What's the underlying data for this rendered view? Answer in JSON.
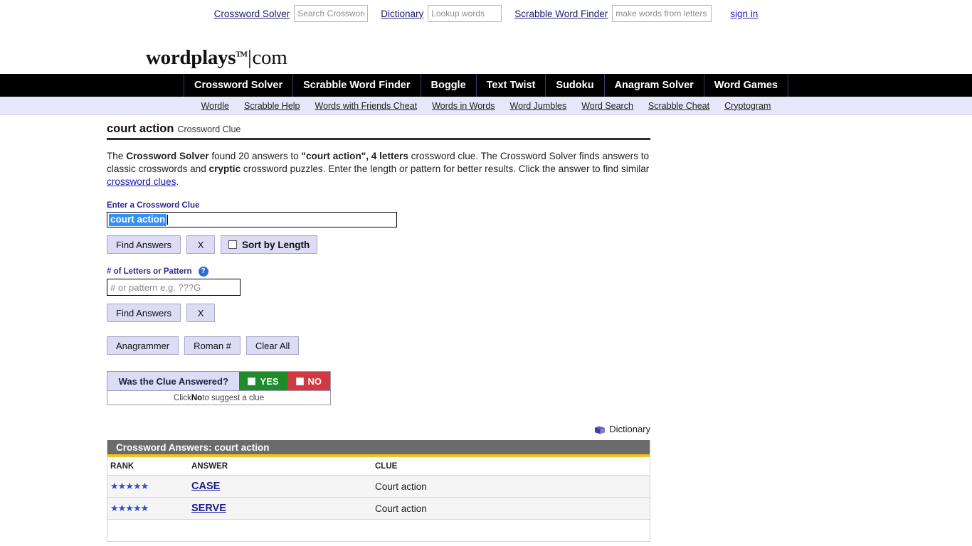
{
  "topbar": {
    "crossword_solver_link": "Crossword Solver",
    "crossword_search_placeholder": "Search Crosswords",
    "dictionary_link": "Dictionary",
    "dictionary_search_placeholder": "Lookup words",
    "scrabble_link": "Scrabble Word Finder",
    "scrabble_search_placeholder": "make words from letters",
    "signin": "sign in"
  },
  "logo": {
    "name": "wordplays",
    "tm": "TM",
    "separator": "|",
    "tld": "com"
  },
  "mainnav": {
    "items": [
      {
        "label": "Crossword Solver"
      },
      {
        "label": "Scrabble Word Finder"
      },
      {
        "label": "Boggle"
      },
      {
        "label": "Text Twist"
      },
      {
        "label": "Sudoku"
      },
      {
        "label": "Anagram Solver"
      },
      {
        "label": "Word Games"
      }
    ]
  },
  "subnav": {
    "items": [
      {
        "label": "Wordle"
      },
      {
        "label": "Scrabble Help"
      },
      {
        "label": "Words with Friends Cheat"
      },
      {
        "label": "Words in Words"
      },
      {
        "label": "Word Jumbles"
      },
      {
        "label": "Word Search"
      },
      {
        "label": "Scrabble Cheat"
      },
      {
        "label": "Cryptogram"
      }
    ]
  },
  "page": {
    "title": "court action",
    "subtitle": "Crossword Clue",
    "blurb": {
      "p1": "The ",
      "solver": "Crossword Solver",
      "p2": " found 20 answers to ",
      "query": "\"court action\", 4 letters",
      "p3": " crossword clue. The Crossword Solver finds answers to classic crosswords and ",
      "cryptic": "cryptic",
      "p4": " crossword puzzles. Enter the length or pattern for better results. Click the answer to find similar ",
      "link": "crossword clues",
      "p5": "."
    }
  },
  "form": {
    "clue_label": "Enter a Crossword Clue",
    "clue_value": "court action",
    "find_answers": "Find Answers",
    "clear_x": "X",
    "sort_by_length": "Sort by Length",
    "pattern_label": "# of Letters or Pattern",
    "help_glyph": "?",
    "pattern_placeholder": "# or pattern e.g. ???G",
    "pattern_value": "",
    "find_answers_2": "Find Answers",
    "clear_x_2": "X",
    "anagrammer": "Anagrammer",
    "roman": "Roman #",
    "clear_all": "Clear All"
  },
  "answered": {
    "question": "Was the Clue Answered?",
    "yes": "YES",
    "no": "NO",
    "note_pre": "Click ",
    "note_bold": "No",
    "note_post": " to suggest a clue"
  },
  "dictionary": {
    "label": "Dictionary"
  },
  "results": {
    "heading": "Crossword Answers: court action",
    "columns": {
      "rank": "RANK",
      "answer": "ANSWER",
      "clue": "CLUE"
    },
    "rows": [
      {
        "stars": "★★★★★",
        "rating": 5,
        "answer": "CASE",
        "clue": "Court action"
      },
      {
        "stars": "★★★★★",
        "rating": 5,
        "answer": "SERVE",
        "clue": "Court action"
      }
    ]
  },
  "colors": {
    "nav_bg": "#000000",
    "subnav_bg": "#e7e7fa",
    "button_bg": "#dcdcf4",
    "selection_blue": "#3390ff",
    "yes_green": "#1f8b2a",
    "no_red": "#d0393f",
    "table_header_gray": "#6b6b6b",
    "table_accent_yellow": "#f0c419",
    "star_blue": "#2b4fd6",
    "link_blue": "#1a1a8c"
  }
}
